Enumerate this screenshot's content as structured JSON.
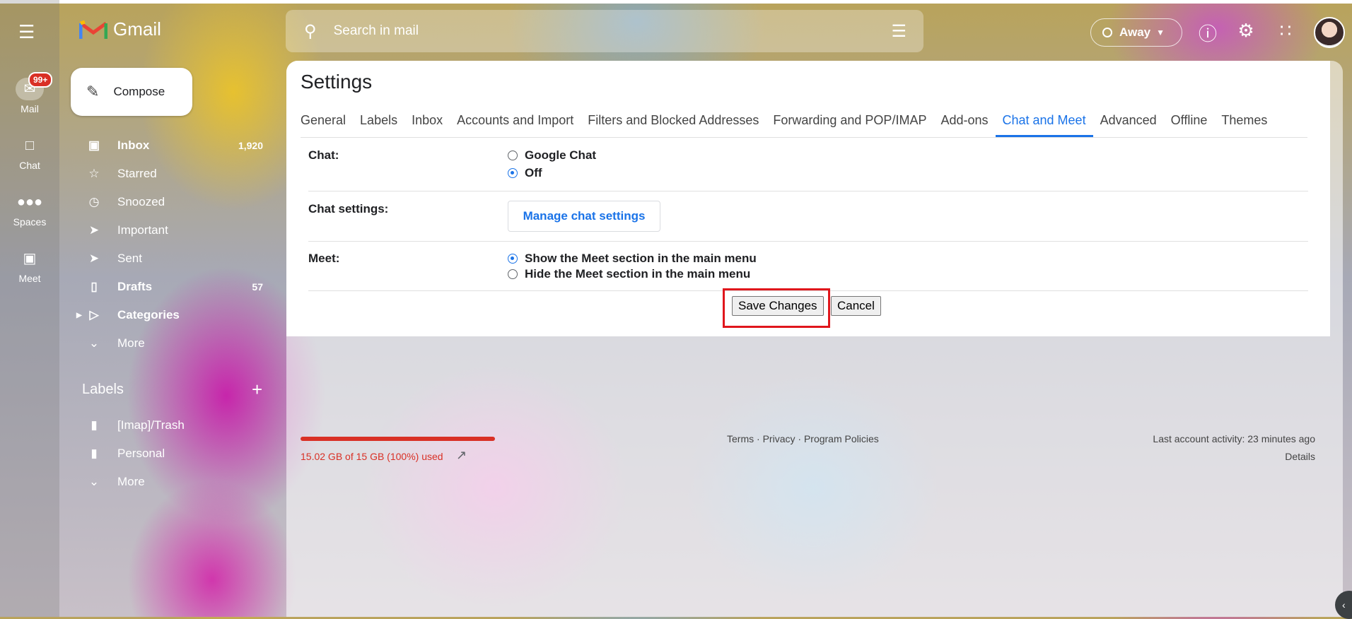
{
  "app": {
    "name": "Gmail"
  },
  "rail": {
    "items": [
      {
        "label": "Mail",
        "badge": "99+"
      },
      {
        "label": "Chat"
      },
      {
        "label": "Spaces"
      },
      {
        "label": "Meet"
      }
    ]
  },
  "compose": {
    "label": "Compose"
  },
  "nav": {
    "items": [
      {
        "label": "Inbox",
        "count": "1,920"
      },
      {
        "label": "Starred"
      },
      {
        "label": "Snoozed"
      },
      {
        "label": "Important"
      },
      {
        "label": "Sent"
      },
      {
        "label": "Drafts",
        "count": "57"
      },
      {
        "label": "Categories"
      },
      {
        "label": "More"
      }
    ]
  },
  "labels": {
    "heading": "Labels",
    "items": [
      {
        "label": "[Imap]/Trash"
      },
      {
        "label": "Personal"
      },
      {
        "label": "More"
      }
    ]
  },
  "search": {
    "placeholder": "Search in mail"
  },
  "status": {
    "label": "Away"
  },
  "settings": {
    "title": "Settings",
    "tabs": [
      "General",
      "Labels",
      "Inbox",
      "Accounts and Import",
      "Filters and Blocked Addresses",
      "Forwarding and POP/IMAP",
      "Add-ons",
      "Chat and Meet",
      "Advanced",
      "Offline",
      "Themes"
    ],
    "active_tab": "Chat and Meet",
    "chat": {
      "label": "Chat:",
      "options": [
        "Google Chat",
        "Off"
      ],
      "selected": "Off"
    },
    "chat_settings": {
      "label": "Chat settings:",
      "button": "Manage chat settings"
    },
    "meet": {
      "label": "Meet:",
      "options": [
        "Show the Meet section in the main menu",
        "Hide the Meet section in the main menu"
      ],
      "selected": "Show the Meet section in the main menu"
    },
    "save_label": "Save Changes",
    "cancel_label": "Cancel"
  },
  "footer": {
    "storage": "15.02 GB of 15 GB (100%) used",
    "storage_fraction": 1.0,
    "terms": "Terms",
    "privacy": "Privacy",
    "policies": "Program Policies",
    "sep": " · ",
    "activity": "Last account activity: 23 minutes ago",
    "details": "Details"
  },
  "colors": {
    "accent": "#1a73e8",
    "storage_warning": "#d93025",
    "highlight": "#e0161c"
  },
  "icons": [
    "menu-icon",
    "mail-icon",
    "chat-icon",
    "spaces-icon",
    "meet-icon",
    "pencil-icon",
    "inbox-icon",
    "star-icon",
    "clock-icon",
    "important-icon",
    "send-icon",
    "draft-icon",
    "label-icon",
    "chevron-down-icon",
    "plus-icon",
    "search-icon",
    "tune-icon",
    "help-icon",
    "gear-icon",
    "apps-icon",
    "open-in-new-icon"
  ]
}
